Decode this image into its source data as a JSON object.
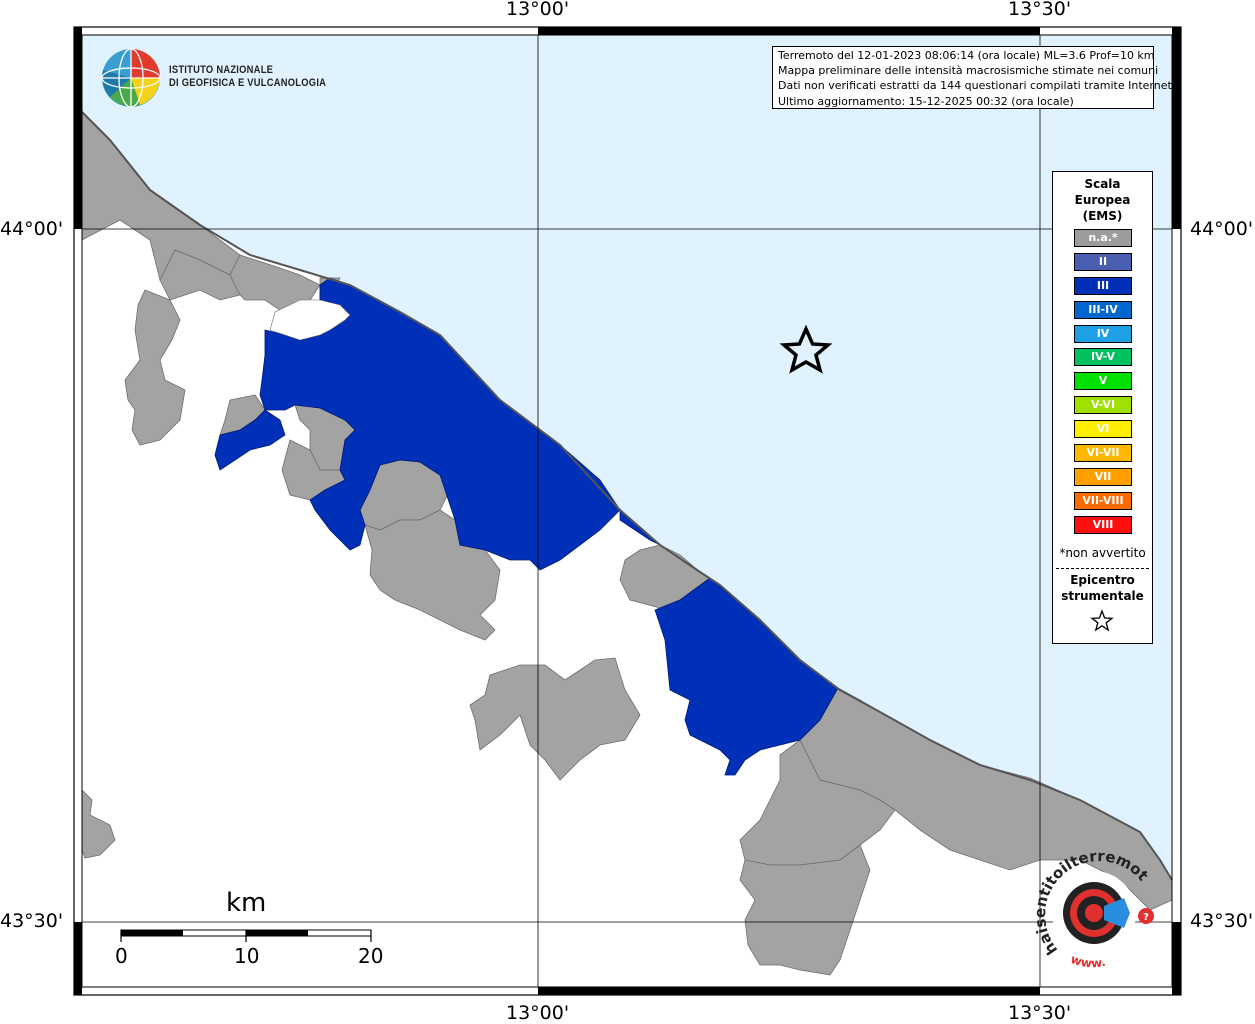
{
  "institute": {
    "name_line1": "ISTITUTO NAZIONALE",
    "name_line2": "DI GEOFISICA E VULCANOLOGIA"
  },
  "coordinates": {
    "top": [
      "13°00'",
      "13°30'"
    ],
    "bottom": [
      "13°00'",
      "13°30'"
    ],
    "left": [
      "44°00'",
      "43°30'"
    ],
    "right": [
      "44°00'",
      "43°30'"
    ]
  },
  "info": {
    "line1": "Terremoto del 12-01-2023 08:06:14 (ora locale) ML=3.6 Prof=10 km",
    "line2": "Mappa preliminare delle intensità macrosismiche stimate nei comuni",
    "line3": "Dati non verificati estratti da 144 questionari compilati tramite Internet.",
    "line4": "Ultimo aggiornamento: 15-12-2025 00:32 (ora locale)"
  },
  "legend": {
    "title_line1": "Scala",
    "title_line2": "Europea",
    "title_line3": "(EMS)",
    "items": [
      {
        "label": "n.a.*",
        "color": "#9c9c9c"
      },
      {
        "label": "II",
        "color": "#4a5fb0"
      },
      {
        "label": "III",
        "color": "#0030b8"
      },
      {
        "label": "III-IV",
        "color": "#0066d0"
      },
      {
        "label": "IV",
        "color": "#1ea0e8"
      },
      {
        "label": "IV-V",
        "color": "#00c060"
      },
      {
        "label": "V",
        "color": "#00e000"
      },
      {
        "label": "V-VI",
        "color": "#a0e000"
      },
      {
        "label": "VI",
        "color": "#ffee00"
      },
      {
        "label": "VI-VII",
        "color": "#ffb800"
      },
      {
        "label": "VII",
        "color": "#ffa000"
      },
      {
        "label": "VII-VIII",
        "color": "#ff6a00"
      },
      {
        "label": "VIII",
        "color": "#ff1010"
      }
    ],
    "note": "*non avvertito",
    "epicenter_line1": "Epicentro",
    "epicenter_line2": "strumentale"
  },
  "scalebar": {
    "unit": "km",
    "labels": [
      "0",
      "10",
      "20"
    ]
  },
  "hsit_logo": {
    "text": "haisentitoilterremoto.it",
    "prefix": "www."
  },
  "colors": {
    "sea": "#e0f2fe",
    "land": "#ffffff",
    "not_available": "#a3a3a3",
    "intensity_III": "#0030b8"
  }
}
